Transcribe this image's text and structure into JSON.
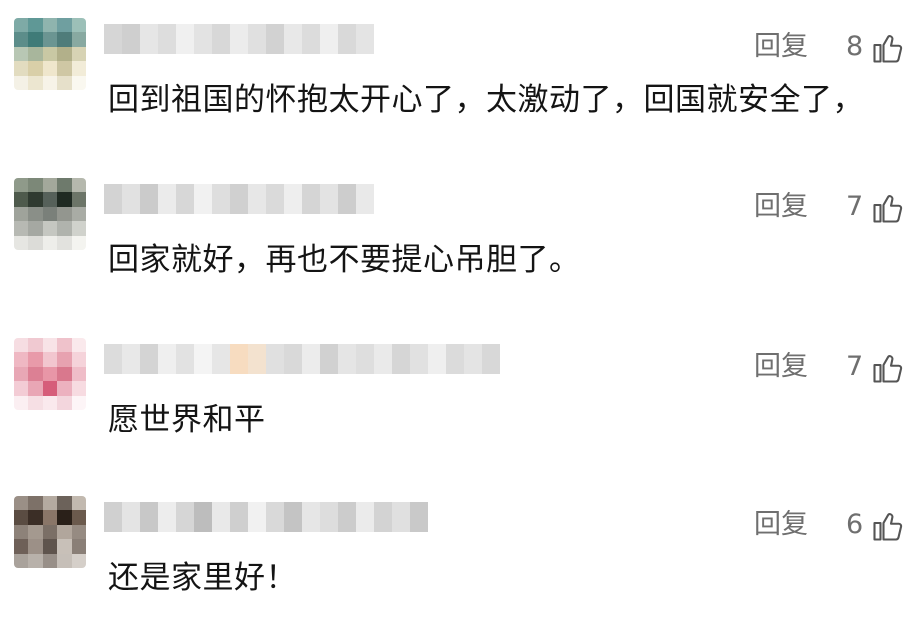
{
  "comments": [
    {
      "reply_label": "回复",
      "like_count": "8",
      "text": "回到祖国的怀抱太开心了，太激动了，回国就安全了，",
      "avatar_colors": [
        "#7eaaa6",
        "#5f9896",
        "#8fb4ae",
        "#6f9fa0",
        "#9cc0b8",
        "#5c8d8a",
        "#3f7b78",
        "#6b9592",
        "#4f7c7a",
        "#88a9a1",
        "#b8c7b4",
        "#a8b69c",
        "#c9c8a4",
        "#b2b08a",
        "#d7d3b4",
        "#e2dcc0",
        "#d9cfa8",
        "#efe6cc",
        "#cfc7a4",
        "#f2ecd8",
        "#f4f1e6",
        "#ece6d0",
        "#f7f3e8",
        "#e6e0ca",
        "#faf8f0"
      ],
      "username_colors": [
        "#d6d6d6",
        "#cfcfcf",
        "#e6e6e6",
        "#dddddd",
        "#f0f0f0",
        "#e3e3e3",
        "#d8d8d8",
        "#ececec",
        "#e0e0e0",
        "#d2d2d2",
        "#e8e8e8",
        "#dcdcdc",
        "#efefef",
        "#d9d9d9",
        "#e4e4e4"
      ]
    },
    {
      "reply_label": "回复",
      "like_count": "7",
      "text": "回家就好，再也不要提心吊胆了。",
      "avatar_colors": [
        "#8f9a8a",
        "#7c8878",
        "#a3a89b",
        "#6e7a6c",
        "#b5b8ad",
        "#4e5a4c",
        "#2f3a30",
        "#56615a",
        "#1f2a22",
        "#6c7568",
        "#9fa39b",
        "#8a8f88",
        "#7a807a",
        "#93968f",
        "#a9aca5",
        "#b7b9b3",
        "#a5a8a2",
        "#c5c7c1",
        "#b0b3ad",
        "#d0d2cc",
        "#e6e6e2",
        "#dcdcd8",
        "#eeeeea",
        "#e2e2de",
        "#f4f4f0"
      ],
      "username_colors": [
        "#d3d3d3",
        "#e1e1e1",
        "#cbcbcb",
        "#ebebeb",
        "#d7d7d7",
        "#f1f1f1",
        "#dedede",
        "#d0d0d0",
        "#e7e7e7",
        "#dadada",
        "#eeeeee",
        "#d5d5d5",
        "#e3e3e3",
        "#cdcdcd",
        "#e9e9e9"
      ]
    },
    {
      "reply_label": "回复",
      "like_count": "7",
      "text": "愿世界和平",
      "avatar_colors": [
        "#f6dde2",
        "#f0c9d1",
        "#f8e3e7",
        "#efc2cb",
        "#fae9ec",
        "#efb8c3",
        "#e89aa9",
        "#f2c6cf",
        "#e7a2b0",
        "#f5d3da",
        "#e8a7b5",
        "#dc8094",
        "#e896a7",
        "#d9788d",
        "#efbdc8",
        "#f3ccd5",
        "#e9a6b5",
        "#d65d7a",
        "#ecb1bf",
        "#f7dbe1",
        "#fbeff2",
        "#f6dfe4",
        "#fae9ed",
        "#f3d6dd",
        "#fdf5f7"
      ],
      "username_colors": [
        "#dcdcdc",
        "#e8e8e8",
        "#d4d4d4",
        "#efefef",
        "#e2e2e2",
        "#f4f4f4",
        "#e6e6e6",
        "#f7dcc0",
        "#f3e2cf",
        "#e0e0e0",
        "#d9d9d9",
        "#ececec",
        "#d1d1d1",
        "#e5e5e5",
        "#dedede",
        "#eaeaea",
        "#d6d6d6",
        "#e1e1e1",
        "#efefef",
        "#dbdbdb",
        "#e4e4e4",
        "#d8d8d8"
      ]
    },
    {
      "reply_label": "回复",
      "like_count": "6",
      "text": "还是家里好！",
      "avatar_colors": [
        "#9a8f86",
        "#7d7168",
        "#b4aaa0",
        "#6c625a",
        "#c2b9af",
        "#5a4c42",
        "#3b2e26",
        "#8a7668",
        "#2a2019",
        "#6b5a4d",
        "#8d8279",
        "#a4998f",
        "#7b6f66",
        "#b1a69c",
        "#968b82",
        "#6e6058",
        "#9c9087",
        "#5f544d",
        "#c8c0b8",
        "#8a7f77",
        "#a9a29b",
        "#b8b1aa",
        "#988f88",
        "#c6bfb8",
        "#d5cfc9"
      ],
      "username_colors": [
        "#d0d0d0",
        "#e4e4e4",
        "#c8c8c8",
        "#ededed",
        "#d6d6d6",
        "#bdbdbd",
        "#e9e9e9",
        "#cfcfcf",
        "#f1f1f1",
        "#d9d9d9",
        "#c4c4c4",
        "#e6e6e6",
        "#dddddd",
        "#cccccc",
        "#ebebeb",
        "#d3d3d3",
        "#e0e0e0",
        "#c9c9c9"
      ]
    }
  ]
}
